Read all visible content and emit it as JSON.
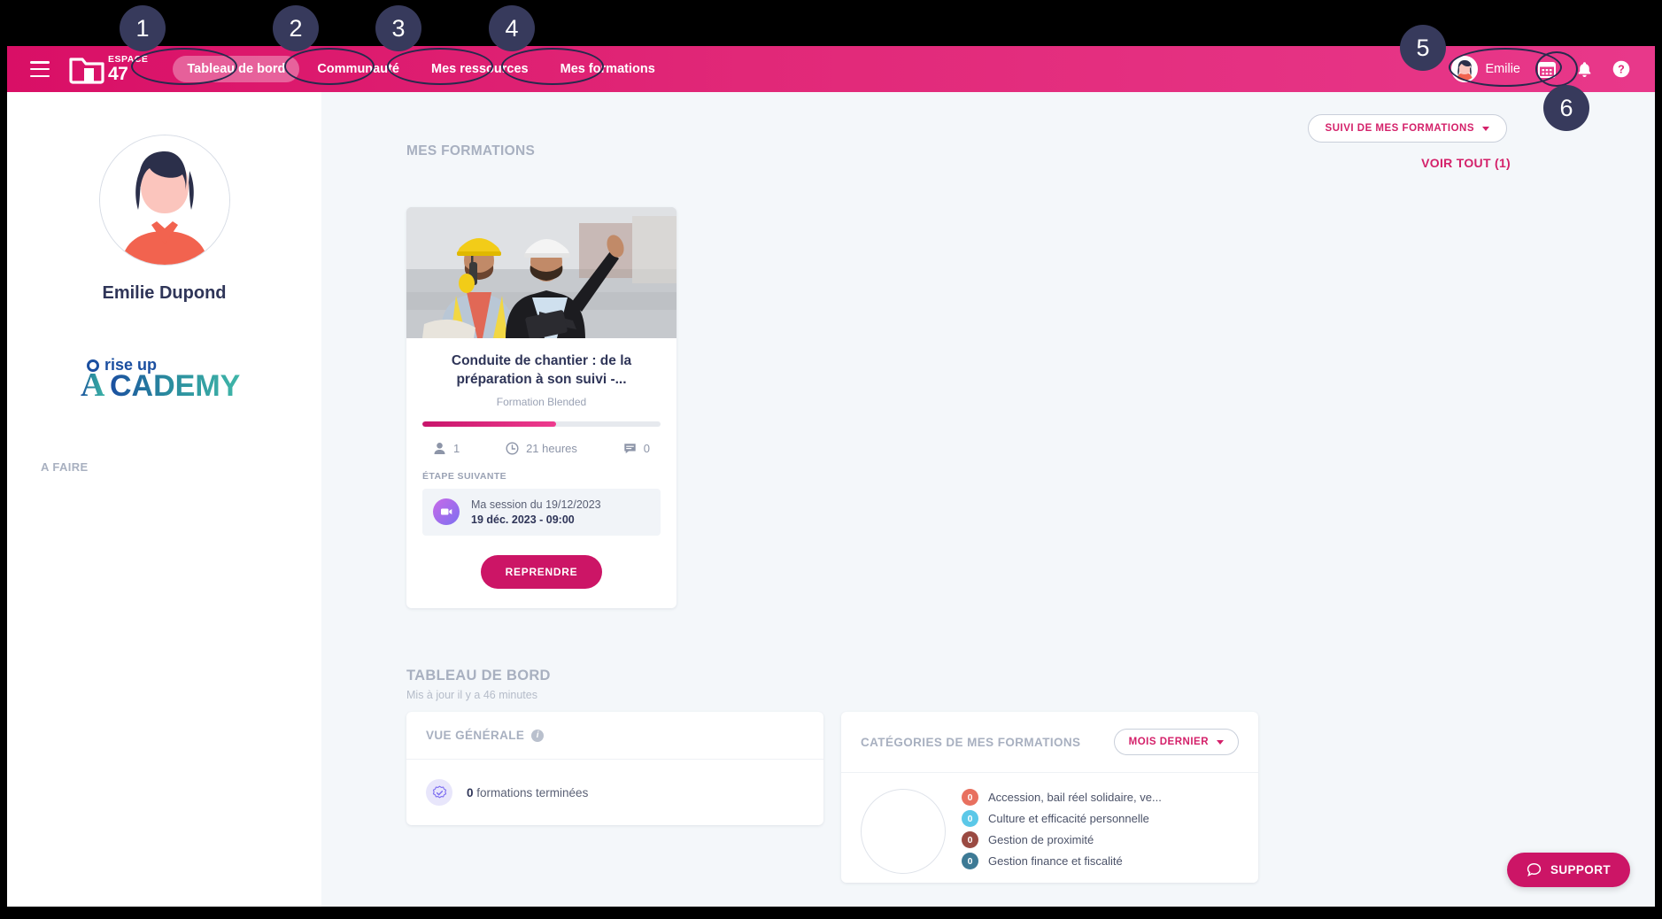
{
  "navbar": {
    "menu_icon": "hamburger-icon",
    "brand": {
      "line1": "ESPACE",
      "line2": "47"
    },
    "links": [
      {
        "label": "Tableau de bord",
        "active": true
      },
      {
        "label": "Communauté",
        "active": false
      },
      {
        "label": "Mes ressources",
        "active": false
      },
      {
        "label": "Mes formations",
        "active": false
      }
    ],
    "user_name": "Emilie",
    "icons": [
      "calendar-icon",
      "bell-icon",
      "help-icon"
    ],
    "background_color": "#e12878"
  },
  "sidebar": {
    "user_fullname": "Emilie Dupond",
    "academy_logo_text": {
      "top": "rise up",
      "main": "ACADEMY"
    },
    "todo_label": "A FAIRE"
  },
  "main": {
    "filter_button": {
      "label": "SUIVI DE MES FORMATIONS",
      "icon": "chevron-down-icon"
    },
    "formations_section_label": "MES FORMATIONS",
    "voir_tout": "VOIR TOUT (1)",
    "course": {
      "title": "Conduite de chantier : de la préparation à son suivi -...",
      "subtitle": "Formation Blended",
      "progress_percent": 56,
      "stats": [
        {
          "icon": "person-icon",
          "value": "1"
        },
        {
          "icon": "clock-icon",
          "value": "21 heures"
        },
        {
          "icon": "comment-icon",
          "value": "0"
        }
      ],
      "next_step_label": "ÉTAPE SUIVANTE",
      "next_step": {
        "icon": "video-session-icon",
        "title": "Ma session du 19/12/2023",
        "datetime": "19 déc. 2023 - 09:00"
      },
      "resume_button": "REPRENDRE"
    },
    "dashboard": {
      "title": "TABLEAU DE BORD",
      "updated": "Mis à jour il y a 46 minutes"
    },
    "overview_panel": {
      "title": "VUE GÉNÉRALE",
      "info_icon": "info-icon",
      "row_icon": "check-badge-icon",
      "count": "0",
      "row_text": " formations terminées"
    },
    "categories_panel": {
      "title": "CATÉGORIES DE MES FORMATIONS",
      "period_button": {
        "label": "MOIS DERNIER",
        "icon": "chevron-down-icon"
      },
      "items": [
        {
          "count": "0",
          "name": "Accession, bail réel solidaire, ve...",
          "color": "#e8705f"
        },
        {
          "count": "0",
          "name": "Culture et efficacité personnelle",
          "color": "#5bc8e8"
        },
        {
          "count": "0",
          "name": "Gestion de proximité",
          "color": "#9a4a42"
        },
        {
          "count": "0",
          "name": "Gestion finance et fiscalité",
          "color": "#3d7a95"
        }
      ]
    }
  },
  "support_button": {
    "label": "SUPPORT",
    "icon": "chat-bubble-icon"
  },
  "annotations": {
    "badges": [
      {
        "number": "1"
      },
      {
        "number": "2"
      },
      {
        "number": "3"
      },
      {
        "number": "4"
      },
      {
        "number": "5"
      },
      {
        "number": "6"
      }
    ]
  },
  "colors": {
    "brand_pink": "#e12878",
    "deep_pink": "#cc1566",
    "navy": "#2f3558",
    "annotation": "#373a5c",
    "page_bg": "#f4f7fa"
  }
}
